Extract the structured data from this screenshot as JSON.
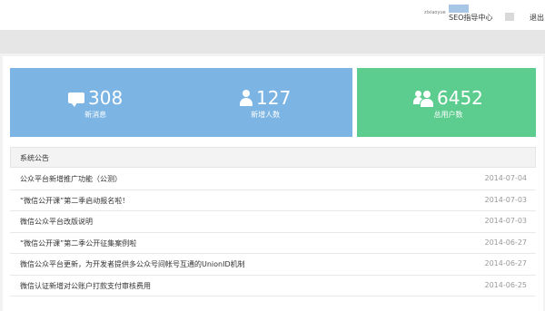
{
  "header": {
    "user_name": "zlxiaoyue",
    "badge_label": "",
    "seo_link": "SEO指导中心",
    "exit_link": "退出"
  },
  "stats": [
    {
      "value": "308",
      "label": "新消息",
      "icon": "message-icon"
    },
    {
      "value": "127",
      "label": "新增人数",
      "icon": "user-icon"
    },
    {
      "value": "6452",
      "label": "总用户数",
      "icon": "users-icon"
    }
  ],
  "announcements": {
    "title": "系统公告",
    "items": [
      {
        "title": "公众平台新增推广功能（公测）",
        "date": "2014-07-04"
      },
      {
        "title": "“微信公开课”第二季启动报名啦！",
        "date": "2014-07-03"
      },
      {
        "title": "微信公众平台改版说明",
        "date": "2014-07-03"
      },
      {
        "title": "“微信公开课”第二季公开征集案例啦",
        "date": "2014-06-27"
      },
      {
        "title": "微信公众平台更新，为开发者提供多公众号间帐号互通的UnionID机制",
        "date": "2014-06-27"
      },
      {
        "title": "微信认证新增对公账户打款支付审核费用",
        "date": "2014-06-25"
      }
    ]
  },
  "colors": {
    "blue_panel": "#7cb5e3",
    "green_panel": "#5dcc8f",
    "band": "#e6e6e6"
  }
}
